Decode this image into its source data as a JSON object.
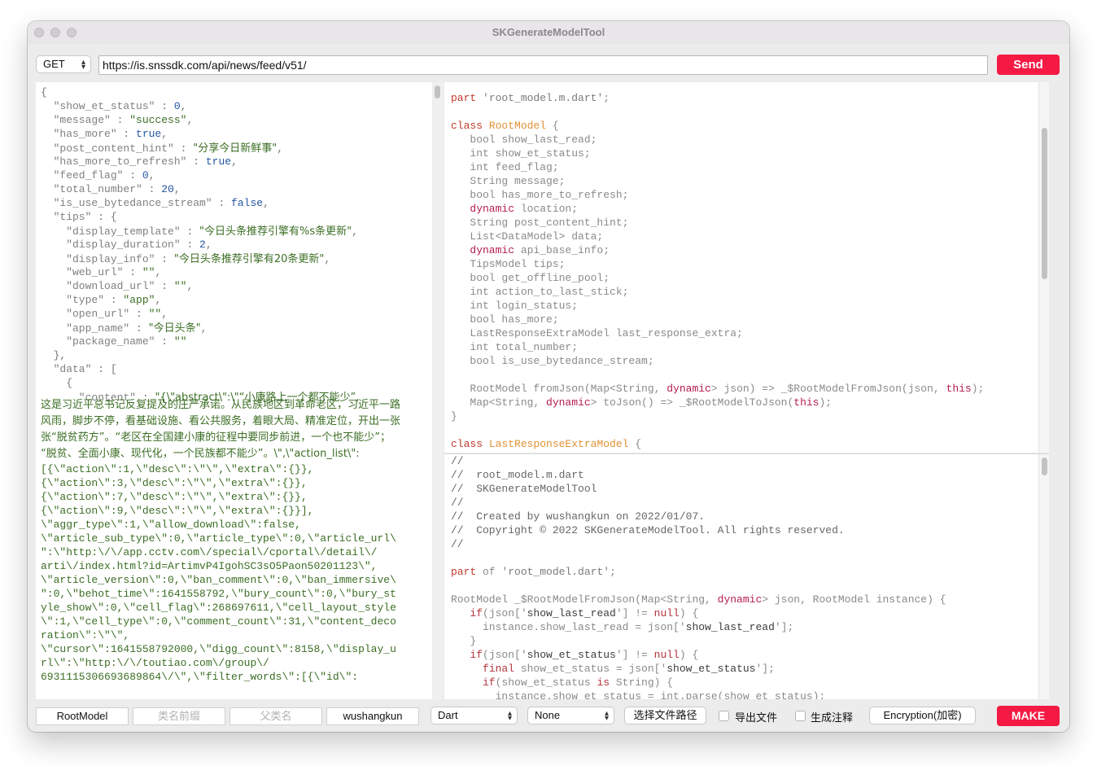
{
  "window": {
    "title": "SKGenerateModelTool"
  },
  "request": {
    "method": "GET",
    "url": "https://is.snssdk.com/api/news/feed/v51/",
    "send_label": "Send"
  },
  "json_lines": [
    [
      [
        "p",
        "{"
      ]
    ],
    [
      [
        "k",
        "  \"show_et_status\""
      ],
      [
        "p",
        " : "
      ],
      [
        "n",
        "0"
      ],
      [
        "p",
        ","
      ]
    ],
    [
      [
        "k",
        "  \"message\""
      ],
      [
        "p",
        " : "
      ],
      [
        "s",
        "\"success\""
      ],
      [
        "p",
        ","
      ]
    ],
    [
      [
        "k",
        "  \"has_more\""
      ],
      [
        "p",
        " : "
      ],
      [
        "b",
        "true"
      ],
      [
        "p",
        ","
      ]
    ],
    [
      [
        "k",
        "  \"post_content_hint\""
      ],
      [
        "p",
        " : "
      ],
      [
        "s",
        "\"分享今日新鲜事\""
      ],
      [
        "p",
        ","
      ]
    ],
    [
      [
        "k",
        "  \"has_more_to_refresh\""
      ],
      [
        "p",
        " : "
      ],
      [
        "b",
        "true"
      ],
      [
        "p",
        ","
      ]
    ],
    [
      [
        "k",
        "  \"feed_flag\""
      ],
      [
        "p",
        " : "
      ],
      [
        "n",
        "0"
      ],
      [
        "p",
        ","
      ]
    ],
    [
      [
        "k",
        "  \"total_number\""
      ],
      [
        "p",
        " : "
      ],
      [
        "n",
        "20"
      ],
      [
        "p",
        ","
      ]
    ],
    [
      [
        "k",
        "  \"is_use_bytedance_stream\""
      ],
      [
        "p",
        " : "
      ],
      [
        "b",
        "false"
      ],
      [
        "p",
        ","
      ]
    ],
    [
      [
        "k",
        "  \"tips\""
      ],
      [
        "p",
        " : {"
      ]
    ],
    [
      [
        "k",
        "    \"display_template\""
      ],
      [
        "p",
        " : "
      ],
      [
        "s",
        "\"今日头条推荐引擎有%s条更新\""
      ],
      [
        "p",
        ","
      ]
    ],
    [
      [
        "k",
        "    \"display_duration\""
      ],
      [
        "p",
        " : "
      ],
      [
        "n",
        "2"
      ],
      [
        "p",
        ","
      ]
    ],
    [
      [
        "k",
        "    \"display_info\""
      ],
      [
        "p",
        " : "
      ],
      [
        "s",
        "\"今日头条推荐引擎有20条更新\""
      ],
      [
        "p",
        ","
      ]
    ],
    [
      [
        "k",
        "    \"web_url\""
      ],
      [
        "p",
        " : "
      ],
      [
        "s",
        "\"\""
      ],
      [
        "p",
        ","
      ]
    ],
    [
      [
        "k",
        "    \"download_url\""
      ],
      [
        "p",
        " : "
      ],
      [
        "s",
        "\"\""
      ],
      [
        "p",
        ","
      ]
    ],
    [
      [
        "k",
        "    \"type\""
      ],
      [
        "p",
        " : "
      ],
      [
        "s",
        "\"app\""
      ],
      [
        "p",
        ","
      ]
    ],
    [
      [
        "k",
        "    \"open_url\""
      ],
      [
        "p",
        " : "
      ],
      [
        "s",
        "\"\""
      ],
      [
        "p",
        ","
      ]
    ],
    [
      [
        "k",
        "    \"app_name\""
      ],
      [
        "p",
        " : "
      ],
      [
        "s",
        "\"今日头条\""
      ],
      [
        "p",
        ","
      ]
    ],
    [
      [
        "k",
        "    \"package_name\""
      ],
      [
        "p",
        " : "
      ],
      [
        "s",
        "\"\""
      ]
    ],
    [
      [
        "p",
        "  },"
      ]
    ],
    [
      [
        "k",
        "  \"data\""
      ],
      [
        "p",
        " : ["
      ]
    ],
    [
      [
        "p",
        "    {"
      ]
    ],
    [
      [
        "k",
        "      \"content\""
      ],
      [
        "p",
        " : "
      ],
      [
        "s",
        "\"{\\\"abstract\\\":\\\"“小康路上一个都不能少”,"
      ]
    ]
  ],
  "json_wrapped": [
    "这是习近平总书记反复提及的庄严承诺。从民族地区到革命老区，习近平一路",
    "风雨，脚步不停，看基础设施、看公共服务，着眼大局、精准定位，开出一张",
    "张“脱贫药方”。“老区在全国建小康的征程中要同步前进，一个也不能少”；",
    "“脱贫、全面小康、现代化，一个民族都不能少”。\\\",\\\"action_list\\\":",
    "[{\\\"action\\\":1,\\\"desc\\\":\\\"\\\",\\\"extra\\\":{}},",
    "{\\\"action\\\":3,\\\"desc\\\":\\\"\\\",\\\"extra\\\":{}},",
    "{\\\"action\\\":7,\\\"desc\\\":\\\"\\\",\\\"extra\\\":{}},",
    "{\\\"action\\\":9,\\\"desc\\\":\\\"\\\",\\\"extra\\\":{}}],",
    "\\\"aggr_type\\\":1,\\\"allow_download\\\":false,",
    "\\\"article_sub_type\\\":0,\\\"article_type\\\":0,\\\"article_url\\",
    "\":\\\"http:\\/\\/app.cctv.com\\/special\\/cportal\\/detail\\/",
    "arti\\/index.html?id=ArtimvP4IgohSC3sO5Paon50201123\\\",",
    "\\\"article_version\\\":0,\\\"ban_comment\\\":0,\\\"ban_immersive\\",
    "\":0,\\\"behot_time\\\":1641558792,\\\"bury_count\\\":0,\\\"bury_st",
    "yle_show\\\":0,\\\"cell_flag\\\":268697611,\\\"cell_layout_style",
    "\\\":1,\\\"cell_type\\\":0,\\\"comment_count\\\":31,\\\"content_deco",
    "ration\\\":\\\"\\\",",
    "\\\"cursor\\\":1641558792000,\\\"digg_count\\\":8158,\\\"display_u",
    "rl\\\":\\\"http:\\/\\/toutiao.com\\/group\\/",
    "6931115306693689864\\/\\\",\\\"filter_words\\\":[{\\\"id\\\":"
  ],
  "code_top_lines": [
    [
      [
        "kw",
        "part"
      ],
      [
        "str",
        " 'root_model.m.dart'"
      ],
      [
        "typ",
        ";"
      ]
    ],
    [
      [
        "typ",
        ""
      ]
    ],
    [
      [
        "kw",
        "class"
      ],
      [
        "cls",
        " RootModel"
      ],
      [
        "typ",
        " {"
      ]
    ],
    [
      [
        "typ",
        "   bool show_last_read;"
      ]
    ],
    [
      [
        "typ",
        "   int show_et_status;"
      ]
    ],
    [
      [
        "typ",
        "   int feed_flag;"
      ]
    ],
    [
      [
        "typ",
        "   String message;"
      ]
    ],
    [
      [
        "typ",
        "   bool has_more_to_refresh;"
      ]
    ],
    [
      [
        "dyn",
        "   dynamic"
      ],
      [
        "typ",
        " location;"
      ]
    ],
    [
      [
        "typ",
        "   String post_content_hint;"
      ]
    ],
    [
      [
        "typ",
        "   List<DataModel> data;"
      ]
    ],
    [
      [
        "dyn",
        "   dynamic"
      ],
      [
        "typ",
        " api_base_info;"
      ]
    ],
    [
      [
        "typ",
        "   TipsModel tips;"
      ]
    ],
    [
      [
        "typ",
        "   bool get_offline_pool;"
      ]
    ],
    [
      [
        "typ",
        "   int action_to_last_stick;"
      ]
    ],
    [
      [
        "typ",
        "   int login_status;"
      ]
    ],
    [
      [
        "typ",
        "   bool has_more;"
      ]
    ],
    [
      [
        "typ",
        "   LastResponseExtraModel last_response_extra;"
      ]
    ],
    [
      [
        "typ",
        "   int total_number;"
      ]
    ],
    [
      [
        "typ",
        "   bool is_use_bytedance_stream;"
      ]
    ],
    [
      [
        "typ",
        ""
      ]
    ],
    [
      [
        "typ",
        "   RootModel fromJson(Map<String, "
      ],
      [
        "dyn",
        "dynamic"
      ],
      [
        "typ",
        "> json) => _$RootModelFromJson(json, "
      ],
      [
        "dyn",
        "this"
      ],
      [
        "typ",
        ");"
      ]
    ],
    [
      [
        "typ",
        "   Map<String, "
      ],
      [
        "dyn",
        "dynamic"
      ],
      [
        "typ",
        "> toJson() => _$RootModelToJson("
      ],
      [
        "dyn",
        "this"
      ],
      [
        "typ",
        ");"
      ]
    ],
    [
      [
        "typ",
        "}"
      ]
    ],
    [
      [
        "typ",
        ""
      ]
    ],
    [
      [
        "kw",
        "class"
      ],
      [
        "cls",
        " LastResponseExtraModel"
      ],
      [
        "typ",
        " {"
      ]
    ]
  ],
  "code_bot_lines": [
    [
      [
        "cmt",
        "//"
      ]
    ],
    [
      [
        "cmt",
        "//  root_model.m.dart"
      ]
    ],
    [
      [
        "cmt",
        "//  SKGenerateModelTool"
      ]
    ],
    [
      [
        "cmt",
        "//"
      ]
    ],
    [
      [
        "cmt",
        "//  Created by wushangkun on 2022/01/07."
      ]
    ],
    [
      [
        "cmt",
        "//  Copyright © 2022 SKGenerateModelTool. All rights reserved."
      ]
    ],
    [
      [
        "cmt",
        "//"
      ]
    ],
    [
      [
        "typ",
        ""
      ]
    ],
    [
      [
        "kw",
        "part"
      ],
      [
        "typ",
        " of"
      ],
      [
        "str",
        " 'root_model.dart'"
      ],
      [
        "typ",
        ";"
      ]
    ],
    [
      [
        "typ",
        ""
      ]
    ],
    [
      [
        "typ",
        "RootModel _$RootModelFromJson(Map<String, "
      ],
      [
        "dyn",
        "dynamic"
      ],
      [
        "typ",
        "> json, RootModel instance) {"
      ]
    ],
    [
      [
        "kw2",
        "   if"
      ],
      [
        "typ",
        "(json['"
      ],
      [
        "strk",
        "show_last_read"
      ],
      [
        "typ",
        "'] != "
      ],
      [
        "nul",
        "null"
      ],
      [
        "typ",
        ") {"
      ]
    ],
    [
      [
        "typ",
        "     instance.show_last_read = json['"
      ],
      [
        "strk",
        "show_last_read"
      ],
      [
        "typ",
        "'];"
      ]
    ],
    [
      [
        "typ",
        "   }"
      ]
    ],
    [
      [
        "kw2",
        "   if"
      ],
      [
        "typ",
        "(json['"
      ],
      [
        "strk",
        "show_et_status"
      ],
      [
        "typ",
        "'] != "
      ],
      [
        "nul",
        "null"
      ],
      [
        "typ",
        ") {"
      ]
    ],
    [
      [
        "kw2",
        "     final"
      ],
      [
        "typ",
        " show_et_status = json['"
      ],
      [
        "strk",
        "show_et_status"
      ],
      [
        "typ",
        "'];"
      ]
    ],
    [
      [
        "kw2",
        "     if"
      ],
      [
        "typ",
        "(show_et_status "
      ],
      [
        "kw2",
        "is"
      ],
      [
        "typ",
        " String) {"
      ]
    ],
    [
      [
        "typ",
        "       instance.show_et_status = int.parse(show_et_status);"
      ]
    ]
  ],
  "bottom_bar": {
    "class_name": "RootModel",
    "class_prefix_placeholder": "类名前缀",
    "parent_class_placeholder": "父类名",
    "author": "wushangkun",
    "language": "Dart",
    "option": "None",
    "choose_path_label": "选择文件路径",
    "export_file_label": "导出文件",
    "gen_comment_label": "生成注释",
    "encryption_label": "Encryption(加密)",
    "make_label": "MAKE"
  },
  "colors": {
    "accent": "#f41a43"
  },
  "icons": [
    "chevron-updown-icon",
    "checkbox-icon"
  ]
}
